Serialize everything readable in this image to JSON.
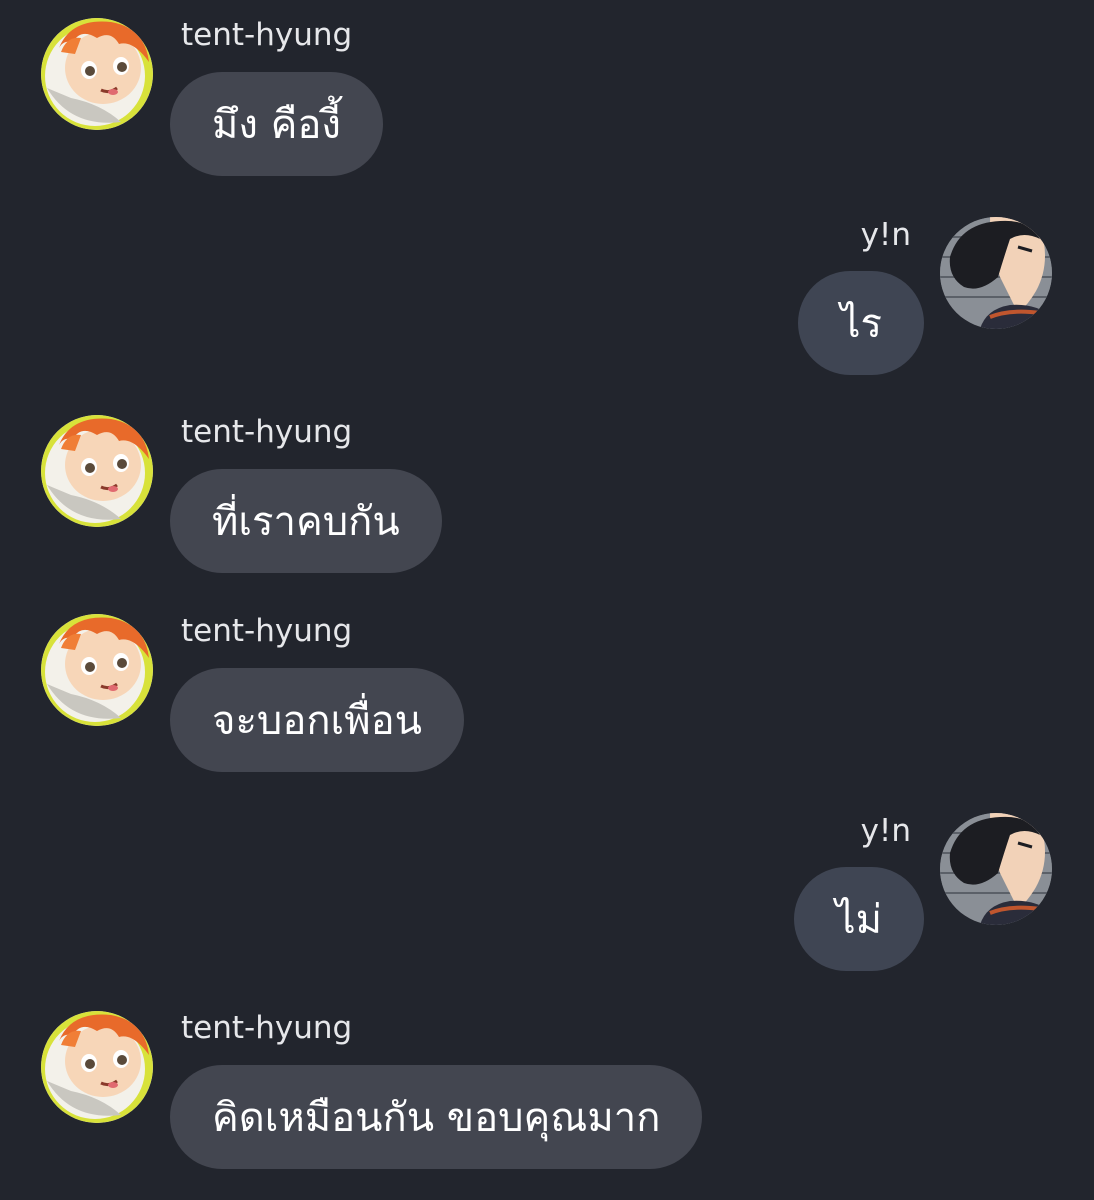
{
  "messages": [
    {
      "sender": "tent-hyung",
      "text": "มึง คืองี้",
      "direction": "incoming"
    },
    {
      "sender": "y!n",
      "text": "ไร",
      "direction": "outgoing"
    },
    {
      "sender": "tent-hyung",
      "text": "ที่เราคบกัน",
      "direction": "incoming"
    },
    {
      "sender": "tent-hyung",
      "text": "จะบอกเพื่อน",
      "direction": "incoming"
    },
    {
      "sender": "y!n",
      "text": "ไม่",
      "direction": "outgoing"
    },
    {
      "sender": "tent-hyung",
      "text": "คิดเหมือนกัน ขอบคุณมาก",
      "direction": "incoming"
    }
  ],
  "avatars": {
    "tent-hyung": "orange-haired-character-avatar",
    "y!n": "dark-haired-character-avatar"
  },
  "colors": {
    "background": "#22252d",
    "incoming_bubble": "#434650",
    "outgoing_bubble": "#3f4553",
    "text": "#ffffff"
  }
}
